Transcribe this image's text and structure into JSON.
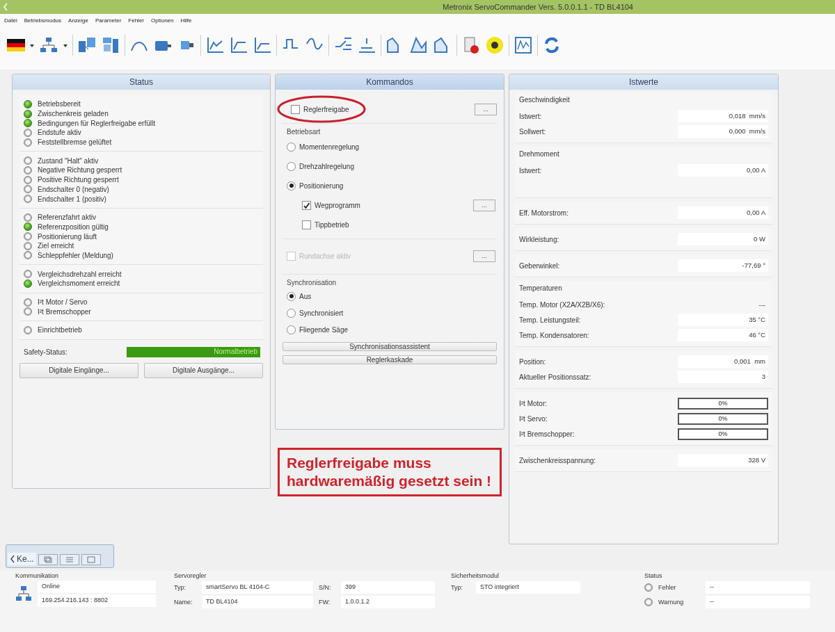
{
  "window": {
    "title": "Metronix ServoCommander Vers. 5.0.0.1.1   -   TD BL4104"
  },
  "menu": [
    "Datei",
    "Betriebsmodus",
    "Anzeige",
    "Parameter",
    "Fehler",
    "Optionen",
    "Hilfe"
  ],
  "status_panel": {
    "title": "Status",
    "groups": [
      [
        {
          "label": "Betriebsbereit",
          "on": true
        },
        {
          "label": "Zwischenkreis geladen",
          "on": true
        },
        {
          "label": "Bedingungen für Reglerfreigabe erfüllt",
          "on": true
        },
        {
          "label": "Endstufe aktiv",
          "on": false
        },
        {
          "label": "Feststellbremse gelüftet",
          "on": false
        }
      ],
      [
        {
          "label": "Zustand \"Halt\" aktiv",
          "on": false
        },
        {
          "label": "Negative Richtung gesperrt",
          "on": false
        },
        {
          "label": "Positive Richtung gesperrt",
          "on": false
        },
        {
          "label": "Endschalter 0 (negativ)",
          "on": false
        },
        {
          "label": "Endschalter 1 (positiv)",
          "on": false
        }
      ],
      [
        {
          "label": "Referenzfahrt aktiv",
          "on": false
        },
        {
          "label": "Referenzposition gültig",
          "on": true
        },
        {
          "label": "Positionierung läuft",
          "on": false
        },
        {
          "label": "Ziel erreicht",
          "on": false
        },
        {
          "label": "Schleppfehler (Meldung)",
          "on": false
        }
      ],
      [
        {
          "label": "Vergleichsdrehzahl erreicht",
          "on": false
        },
        {
          "label": "Vergleichsmoment erreicht",
          "on": true
        }
      ],
      [
        {
          "label": "I²t Motor / Servo",
          "on": false
        },
        {
          "label": "I²t Bremschopper",
          "on": false
        }
      ],
      [
        {
          "label": "Einrichtbetrieb",
          "on": false
        }
      ]
    ],
    "safety_label": "Safety-Status:",
    "safety_value": "Normalbetrieb",
    "buttons": [
      "Digitale Eingänge...",
      "Digitale Ausgänge..."
    ]
  },
  "kommandos": {
    "title": "Kommandos",
    "enable": {
      "label": "Reglerfreigabe",
      "checked": false,
      "circled": true,
      "more": "..."
    },
    "mode_label": "Betriebsart",
    "modes": [
      {
        "label": "Momentenregelung",
        "selected": false
      },
      {
        "label": "Drehzahlregelung",
        "selected": false
      },
      {
        "label": "Positionierung",
        "selected": true
      }
    ],
    "options": [
      {
        "label": "Wegprogramm",
        "checked": true,
        "more": "..."
      },
      {
        "label": "Tippbetrieb",
        "checked": false
      }
    ],
    "rundachse": {
      "label": "Rundachse aktiv",
      "checked": false,
      "disabled": true,
      "more": "..."
    },
    "sync_label": "Synchronisation",
    "sync_modes": [
      {
        "label": "Aus",
        "selected": true
      },
      {
        "label": "Synchronisiert",
        "selected": false
      },
      {
        "label": "Fliegende Säge",
        "selected": false
      }
    ],
    "buttons": [
      "Synchronisationsassistent",
      "Reglerkaskade"
    ]
  },
  "annotation": {
    "text": "Reglerfreigabe muss hardwaremäßig gesetzt sein !"
  },
  "istwerte": {
    "title": "Istwerte",
    "sections": [
      {
        "heading": "Geschwindigkeit",
        "rows": [
          {
            "kind": "field",
            "label": "Istwert:",
            "value": "0,018  mm/s"
          },
          {
            "kind": "field",
            "label": "Sollwert:",
            "value": "0,000  mm/s"
          }
        ]
      },
      {
        "heading": "Drehmoment",
        "rows": [
          {
            "kind": "field",
            "label": "Istwert:",
            "value": "0,00 A"
          }
        ],
        "tall": true
      },
      {
        "rows": [
          {
            "kind": "field",
            "label": "Eff. Motorstrom:",
            "value": "0,00 A"
          }
        ]
      },
      {
        "rows": [
          {
            "kind": "field",
            "label": "Wirkleistung:",
            "value": "0 W"
          }
        ]
      },
      {
        "rows": [
          {
            "kind": "field",
            "label": "Geberwinkel:",
            "value": "-77,69 °"
          }
        ]
      },
      {
        "heading": "Temperaturen",
        "rows": [
          {
            "kind": "plain",
            "label": "Temp. Motor (X2A/X2B/X6):",
            "value": "---"
          },
          {
            "kind": "field",
            "label": "Temp. Leistungsteil:",
            "value": "35 °C"
          },
          {
            "kind": "field",
            "label": "Temp. Kondensatoren:",
            "value": "46 °C"
          }
        ]
      },
      {
        "rows": [
          {
            "kind": "field",
            "label": "Position:",
            "value": "0,001  mm"
          },
          {
            "kind": "field",
            "label": "Aktueller Positionssatz:",
            "value": "3"
          }
        ]
      },
      {
        "rows": [
          {
            "kind": "meter",
            "label": "I²t Motor:",
            "value": "0%",
            "level": 0
          },
          {
            "kind": "meter",
            "label": "I²t Servo:",
            "value": "0%",
            "level": 0
          },
          {
            "kind": "meter",
            "label": "I²t Bremschopper:",
            "value": "0%",
            "level": 0
          }
        ]
      },
      {
        "rows": [
          {
            "kind": "field",
            "label": "Zwischenkreisspannung:",
            "value": "328 V"
          }
        ]
      }
    ]
  },
  "dock_tabs": [
    {
      "label": "Ke...",
      "selected": true
    }
  ],
  "info_bar": {
    "kommunikation": {
      "title": "Kommunikation",
      "status": "Online",
      "address": "169.254.216.143 : 8802"
    },
    "servoregler": {
      "title": "Servoregler",
      "rows": [
        {
          "label": "Typ:",
          "value": "smartServo BL 4104-C",
          "label2": "S/N:",
          "value2": "399"
        },
        {
          "label": "Name:",
          "value": "TD BL4104",
          "label2": "FW:",
          "value2": "1.0.0.1.2"
        }
      ]
    },
    "sicherheitsmodul": {
      "title": "Sicherheitsmodul",
      "label": "Typ:",
      "value": "STO integriert"
    },
    "status": {
      "title": "Status",
      "items": [
        {
          "label": "Fehler",
          "on": false,
          "value": "--"
        },
        {
          "label": "Warnung",
          "on": false,
          "value": "--"
        }
      ]
    }
  }
}
